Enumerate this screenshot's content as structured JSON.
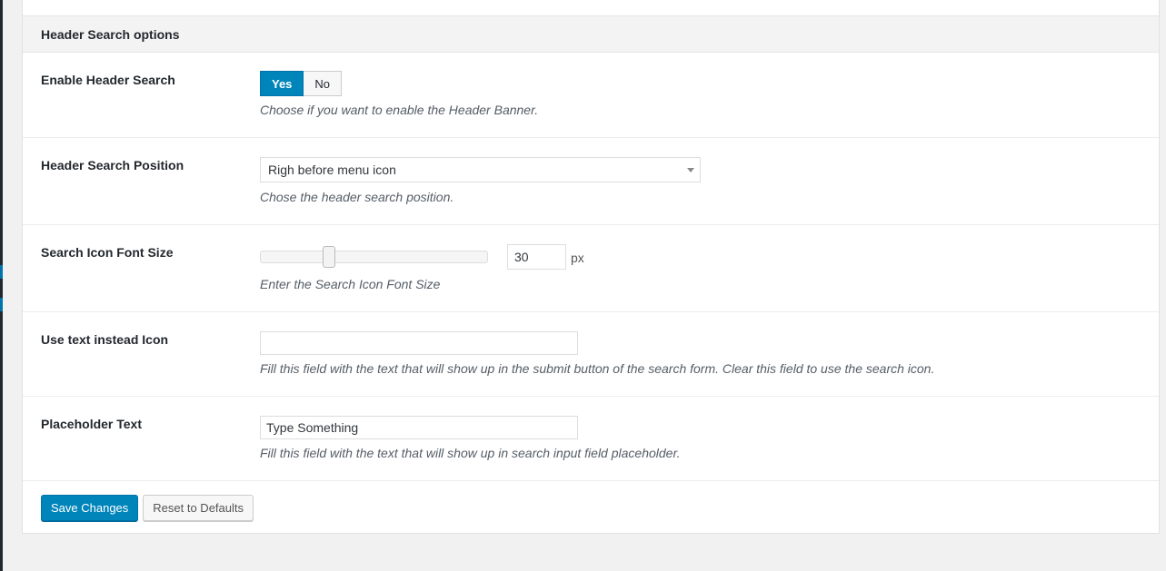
{
  "section": {
    "title": "Header Search options"
  },
  "rows": {
    "enable": {
      "label": "Enable Header Search",
      "options": [
        "Yes",
        "No"
      ],
      "selected": "Yes",
      "description": "Choose if you want to enable the Header Banner."
    },
    "position": {
      "label": "Header Search Position",
      "value": "Righ before menu icon",
      "description": "Chose the header search position."
    },
    "font_size": {
      "label": "Search Icon Font Size",
      "value": "30",
      "unit": "px",
      "description": "Enter the Search Icon Font Size"
    },
    "text_instead": {
      "label": "Use text instead Icon",
      "value": "",
      "description": "Fill this field with the text that will show up in the submit button of the search form. Clear this field to use the search icon."
    },
    "placeholder": {
      "label": "Placeholder Text",
      "value": "Type Something",
      "description": "Fill this field with the text that will show up in search input field placeholder."
    }
  },
  "actions": {
    "save_label": "Save Changes",
    "reset_label": "Reset to Defaults"
  },
  "colors": {
    "primary": "#0085ba",
    "admin_bar": "#23282d"
  }
}
